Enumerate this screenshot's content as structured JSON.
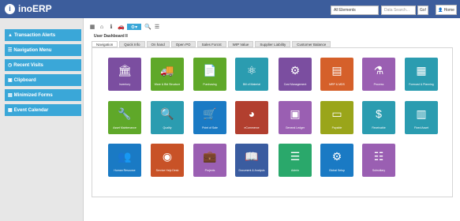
{
  "app": {
    "name": "inoERP"
  },
  "header": {
    "search_scope": "All Elements",
    "search_placeholder": "Data Search...",
    "go_label": "Go!",
    "user_label": "Home"
  },
  "sidebar": {
    "items": [
      {
        "label": "Transaction Alerts",
        "icon": "warning-icon"
      },
      {
        "label": "Navigation Menu",
        "icon": "menu-icon"
      },
      {
        "label": "Recent Visits",
        "icon": "history-icon"
      },
      {
        "label": "Clipboard",
        "icon": "clipboard-icon"
      },
      {
        "label": "Minimized Forms",
        "icon": "window-icon"
      },
      {
        "label": "Event Calendar",
        "icon": "calendar-icon"
      }
    ]
  },
  "main": {
    "dashboard_title": "User Dashboard II",
    "tabs": [
      "Navigation",
      "Quick Info",
      "On hand",
      "Open PO",
      "Sales Forcst",
      "WIP Value",
      "Supplier Liability",
      "Customer Balance"
    ],
    "active_tab": 0,
    "tiles": [
      {
        "label": "Inventory",
        "color": "#7b4ea0",
        "glyph": "🏛"
      },
      {
        "label": "Ware & Bld Structure",
        "color": "#5fa829",
        "glyph": "🚚"
      },
      {
        "label": "Purchasing",
        "color": "#5fa829",
        "glyph": "📄"
      },
      {
        "label": "Bill of Material",
        "color": "#2b9cb0",
        "glyph": "⚛"
      },
      {
        "label": "Cost Management",
        "color": "#7b4ea0",
        "glyph": "⚙"
      },
      {
        "label": "MRP & MDS",
        "color": "#d5602a",
        "glyph": "▤"
      },
      {
        "label": "Process",
        "color": "#9a5fb2",
        "glyph": "⚗"
      },
      {
        "label": "Forecast & Planning",
        "color": "#2b9cb0",
        "glyph": "▦"
      },
      {
        "label": "Asset Maintenance",
        "color": "#5fa829",
        "glyph": "🔧"
      },
      {
        "label": "Quality",
        "color": "#2b9cb0",
        "glyph": "🔍"
      },
      {
        "label": "Point of Sale",
        "color": "#1a7ac4",
        "glyph": "🛒"
      },
      {
        "label": "eCommerce",
        "color": "#b23f2f",
        "glyph": "◕"
      },
      {
        "label": "General Ledger",
        "color": "#9a5fb2",
        "glyph": "▣"
      },
      {
        "label": "Payable",
        "color": "#9aa51a",
        "glyph": "▭"
      },
      {
        "label": "Receivable",
        "color": "#2b9cb0",
        "glyph": "$"
      },
      {
        "label": "Fixed Asset",
        "color": "#2b9cb0",
        "glyph": "▥"
      },
      {
        "label": "Human Resource",
        "color": "#1a7ac4",
        "glyph": "👥"
      },
      {
        "label": "Service Help Desk",
        "color": "#c85227",
        "glyph": "◉"
      },
      {
        "label": "Projects",
        "color": "#9a5fb2",
        "glyph": "💼"
      },
      {
        "label": "Document & Analysis",
        "color": "#3a5ca0",
        "glyph": "📖"
      },
      {
        "label": "Admin",
        "color": "#2aa86b",
        "glyph": "☰"
      },
      {
        "label": "Global Setup",
        "color": "#1a7ac4",
        "glyph": "⚙"
      },
      {
        "label": "Subsidiary",
        "color": "#9a5fb2",
        "glyph": "☷"
      }
    ]
  }
}
